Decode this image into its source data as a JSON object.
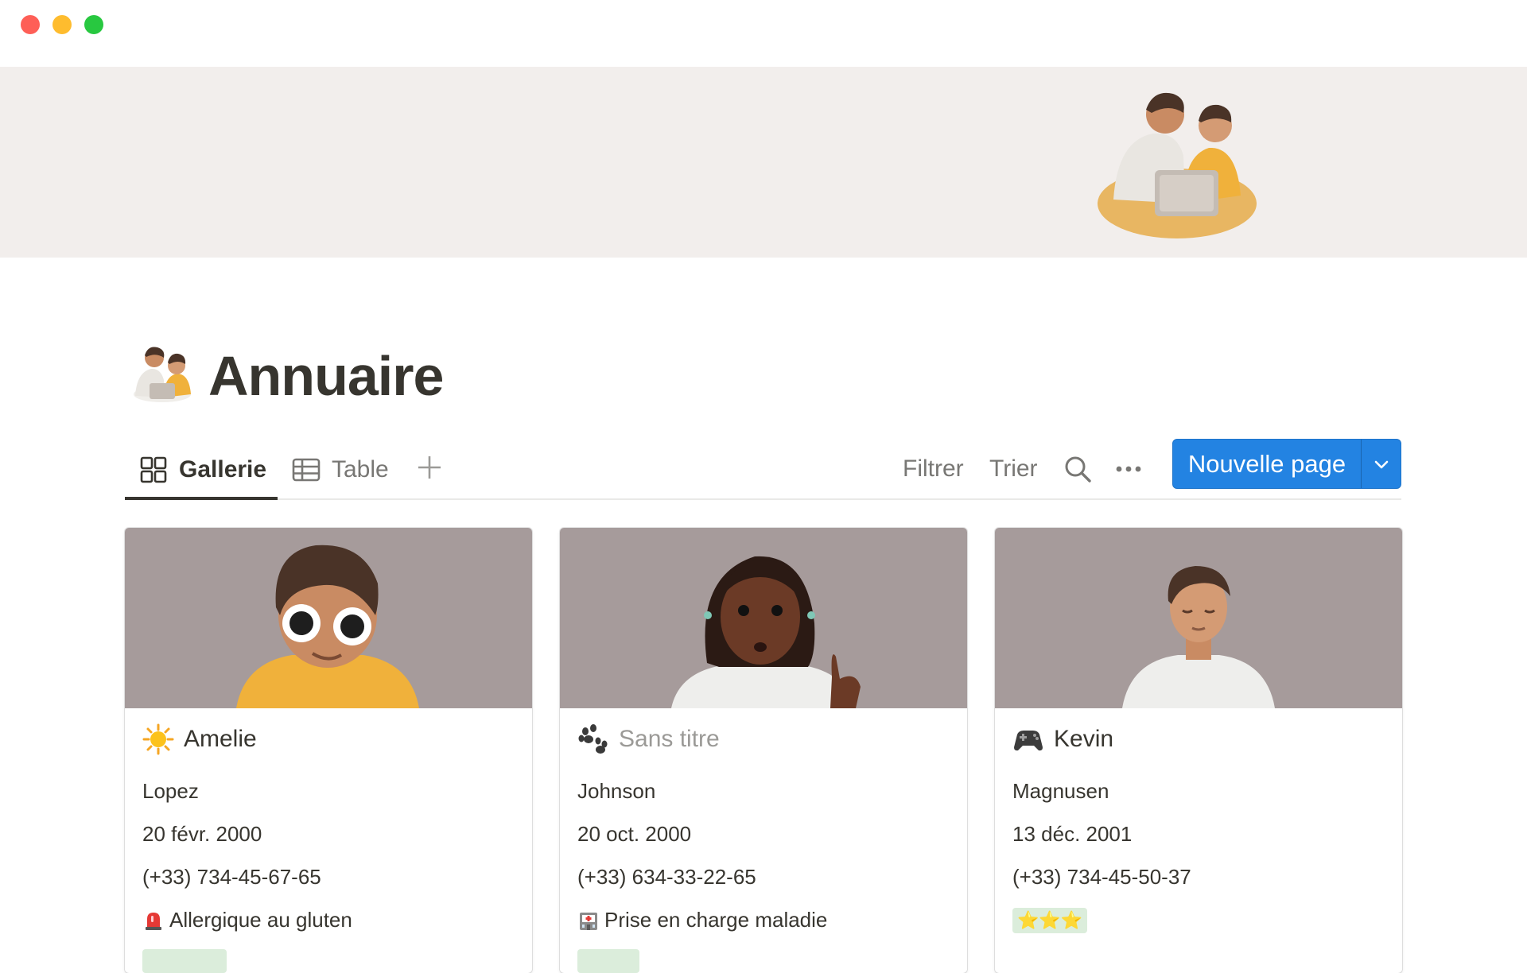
{
  "window": {
    "controls": [
      "close",
      "minimize",
      "maximize"
    ]
  },
  "page": {
    "title": "Annuaire",
    "icon": "people-laptop-icon",
    "cover_icon": "people-laptop-illustration"
  },
  "views": {
    "tabs": [
      {
        "label": "Gallerie",
        "icon": "gallery-grid-icon",
        "active": true
      },
      {
        "label": "Table",
        "icon": "table-icon",
        "active": false
      }
    ],
    "add_view_icon": "plus-icon"
  },
  "toolbar": {
    "filter_label": "Filtrer",
    "sort_label": "Trier",
    "search_icon": "search-icon",
    "more_icon": "ellipsis-icon",
    "new_page_label": "Nouvelle page",
    "new_page_dropdown_icon": "chevron-down-icon"
  },
  "cards": [
    {
      "title_icon": "sun-icon",
      "title": "Amelie",
      "last_name": "Lopez",
      "birth_date": "20 févr. 2000",
      "phone": "(+33) 734-45-67-65",
      "note_icon": "siren-icon",
      "note": "Allergique au gluten",
      "tag_color": "#dbeddb"
    },
    {
      "title_icon": "paw-prints-icon",
      "title": "Sans titre",
      "last_name": "Johnson",
      "birth_date": "20 oct. 2000",
      "phone": "(+33) 634-33-22-65",
      "note_icon": "hospital-icon",
      "note": "Prise en charge maladie",
      "tag_color": "#dbeddb"
    },
    {
      "title_icon": "gamepad-icon",
      "title": "Kevin",
      "last_name": "Magnusen",
      "birth_date": "13 déc. 2001",
      "phone": "(+33) 734-45-50-37",
      "rating": "⭐⭐⭐",
      "rating_color": "#dbeddb"
    }
  ],
  "colors": {
    "accent": "#2383e2",
    "cover_bg": "#f2eeec",
    "card_cover_bg": "#a69b9b",
    "text": "#37352f",
    "muted": "#787774"
  }
}
